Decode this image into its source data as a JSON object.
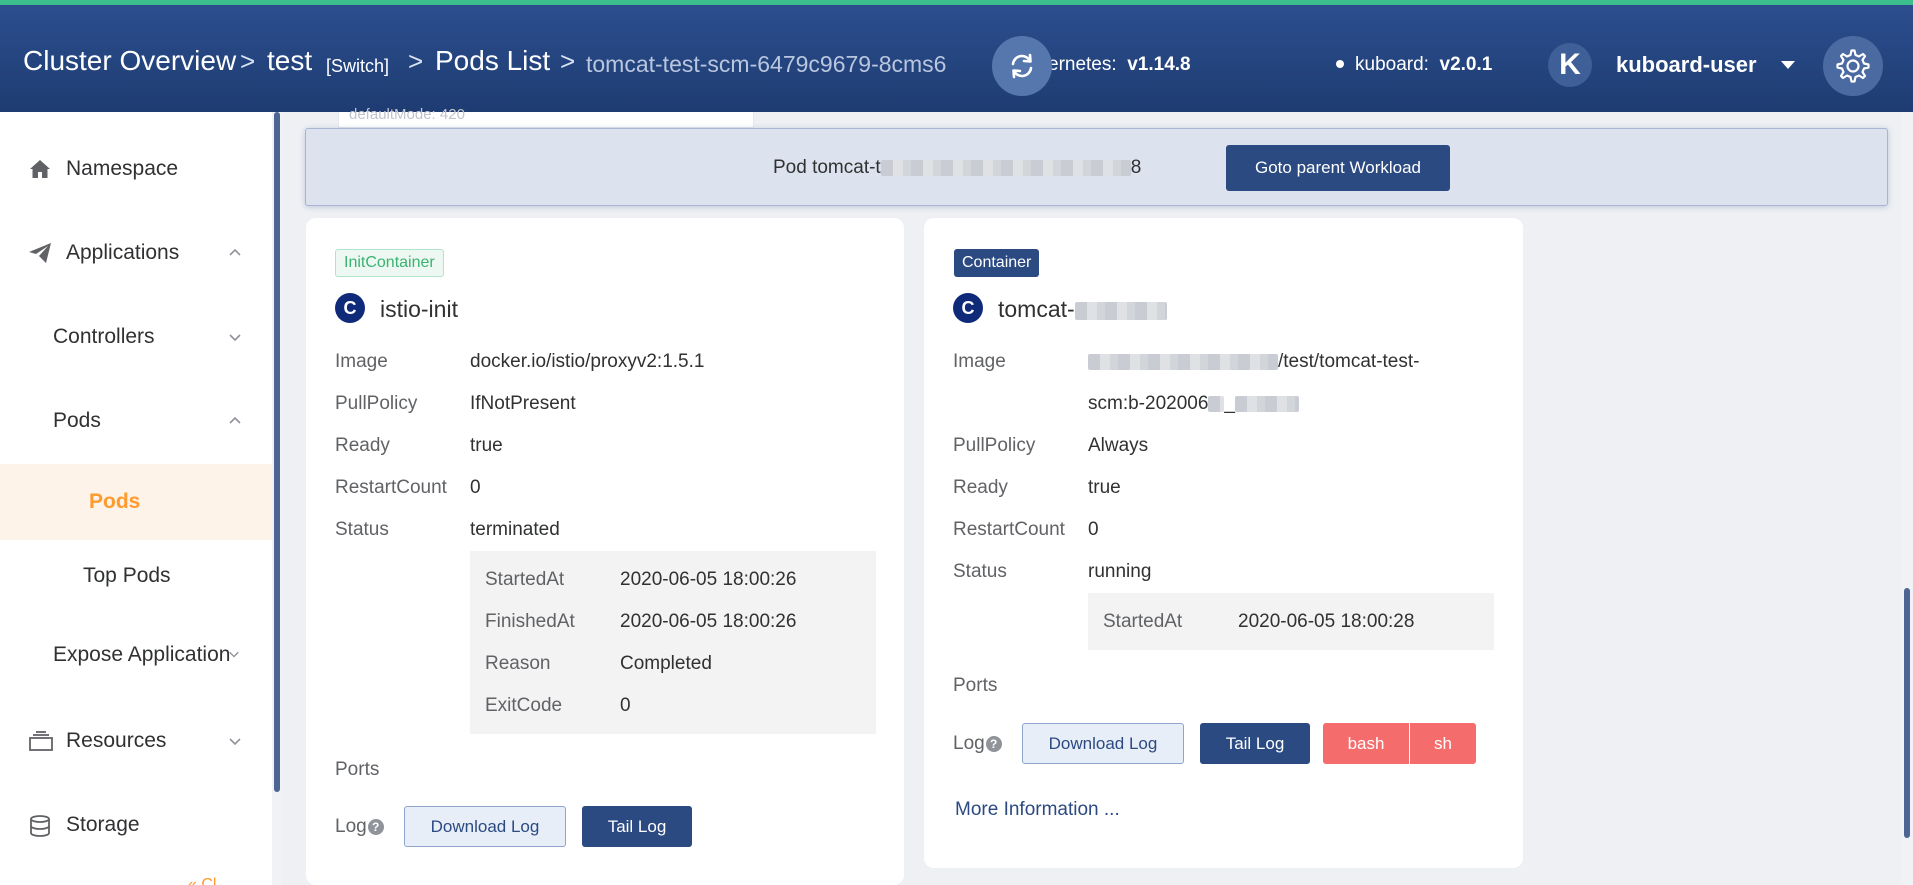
{
  "header": {
    "breadcrumb_cluster": "Cluster Overview",
    "breadcrumb_sep": ">",
    "namespace": "test",
    "switch_label": "[Switch]",
    "pods_list": "Pods List",
    "pod_name": "tomcat-test-scm-6479c9679-8cms6",
    "kubernetes_label": "ernetes:",
    "kubernetes_version": "v1.14.8",
    "kuboard_label": "kuboard:",
    "kuboard_version": "v2.0.1",
    "avatar_letter": "K",
    "username": "kuboard-user"
  },
  "sidebar": {
    "items": [
      {
        "label": "Namespace",
        "icon": "home-icon"
      },
      {
        "label": "Applications",
        "icon": "paper-plane-icon"
      },
      {
        "label": "Controllers"
      },
      {
        "label": "Pods"
      },
      {
        "label": "Pods",
        "active": true
      },
      {
        "label": "Top Pods"
      },
      {
        "label": "Expose Application"
      },
      {
        "label": "Resources",
        "icon": "layers-icon"
      },
      {
        "label": "Storage",
        "icon": "database-icon"
      }
    ],
    "partial_text": "« Cl"
  },
  "ghost_text": "defaultMode: 420",
  "banner": {
    "pod_prefix": "Pod tomcat-t",
    "pod_suffix": "8",
    "goto_parent": "Goto parent Workload"
  },
  "init_container": {
    "tag": "InitContainer",
    "icon_letter": "C",
    "name": "istio-init",
    "image_label": "Image",
    "image": "docker.io/istio/proxyv2:1.5.1",
    "pullpolicy_label": "PullPolicy",
    "pullpolicy": "IfNotPresent",
    "ready_label": "Ready",
    "ready": "true",
    "restart_label": "RestartCount",
    "restart": "0",
    "status_label": "Status",
    "status": "terminated",
    "state": {
      "started_label": "StartedAt",
      "started": "2020-06-05 18:00:26",
      "finished_label": "FinishedAt",
      "finished": "2020-06-05 18:00:26",
      "reason_label": "Reason",
      "reason": "Completed",
      "exit_label": "ExitCode",
      "exit": "0"
    },
    "ports_label": "Ports",
    "log_label": "Log",
    "download_log": "Download Log",
    "tail_log": "Tail Log"
  },
  "container": {
    "tag": "Container",
    "icon_letter": "C",
    "name_prefix": "tomcat-",
    "image_label": "Image",
    "image_line1_suffix": "/test/tomcat-test-",
    "image_line2_prefix": "scm:b-202006",
    "image_line2_mid": "_",
    "pullpolicy_label": "PullPolicy",
    "pullpolicy": "Always",
    "ready_label": "Ready",
    "ready": "true",
    "restart_label": "RestartCount",
    "restart": "0",
    "status_label": "Status",
    "status": "running",
    "state": {
      "started_label": "StartedAt",
      "started": "2020-06-05 18:00:28"
    },
    "ports_label": "Ports",
    "log_label": "Log",
    "download_log": "Download Log",
    "tail_log": "Tail Log",
    "bash": "bash",
    "sh": "sh",
    "more_info": "More Information ..."
  },
  "colors": {
    "header_bg": "#1e3c72",
    "primary": "#2b4a82",
    "active": "#ff9a2e",
    "danger": "#f56c6c",
    "success": "#3cb371"
  }
}
